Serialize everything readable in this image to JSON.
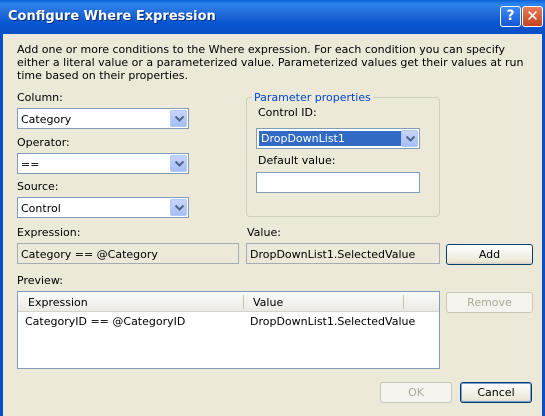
{
  "window": {
    "title": "Configure Where Expression",
    "help_glyph": "?",
    "close_glyph": "✕"
  },
  "description": "Add one or more conditions to the Where expression. For each condition you can specify either a literal value or a parameterized value. Parameterized values get their values at run time based on their properties.",
  "column": {
    "label": "Column:",
    "value": "Category"
  },
  "operator": {
    "label": "Operator:",
    "value": "=="
  },
  "source": {
    "label": "Source:",
    "value": "Control"
  },
  "parameter_properties": {
    "title": "Parameter properties",
    "control_id_label": "Control ID:",
    "control_id_value": "DropDownList1",
    "default_value_label": "Default value:",
    "default_value": ""
  },
  "expression": {
    "label": "Expression:",
    "value": "Category == @Category"
  },
  "value": {
    "label": "Value:",
    "value": "DropDownList1.SelectedValue"
  },
  "buttons": {
    "add": "Add",
    "remove": "Remove",
    "ok": "OK",
    "cancel": "Cancel"
  },
  "preview": {
    "label": "Preview:",
    "columns": [
      "Expression",
      "Value"
    ],
    "rows": [
      {
        "expression": "CategoryID == @CategoryID",
        "value": "DropDownList1.SelectedValue"
      }
    ]
  },
  "colors": {
    "titlebar": "#0a5fd6",
    "dialog_bg": "#ece9d8",
    "selection": "#316ac5",
    "group_title": "#0046d5"
  },
  "icons": [
    "help-icon",
    "close-icon",
    "chevron-down-icon"
  ]
}
